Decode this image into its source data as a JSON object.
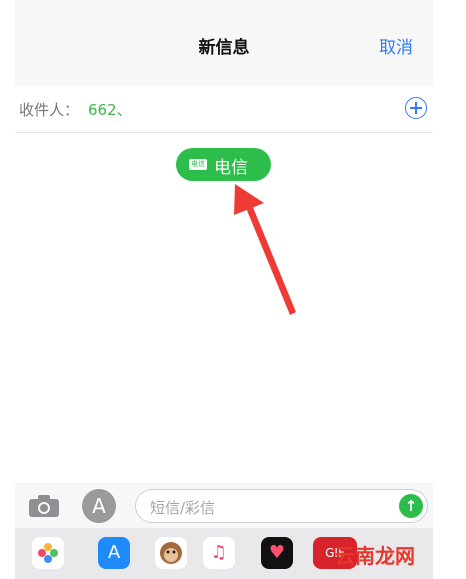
{
  "nav": {
    "title": "新信息",
    "cancel": "取消"
  },
  "recipient": {
    "label": "收件人：",
    "value": "662、"
  },
  "carrier_chip": {
    "badge": "电信",
    "label": "电信"
  },
  "input": {
    "placeholder": "短信/彩信"
  },
  "watermark": "云南龙网",
  "colors": {
    "accent": "#2f7bf6",
    "green": "#2dbd4a",
    "arrow": "#ef3b36"
  }
}
